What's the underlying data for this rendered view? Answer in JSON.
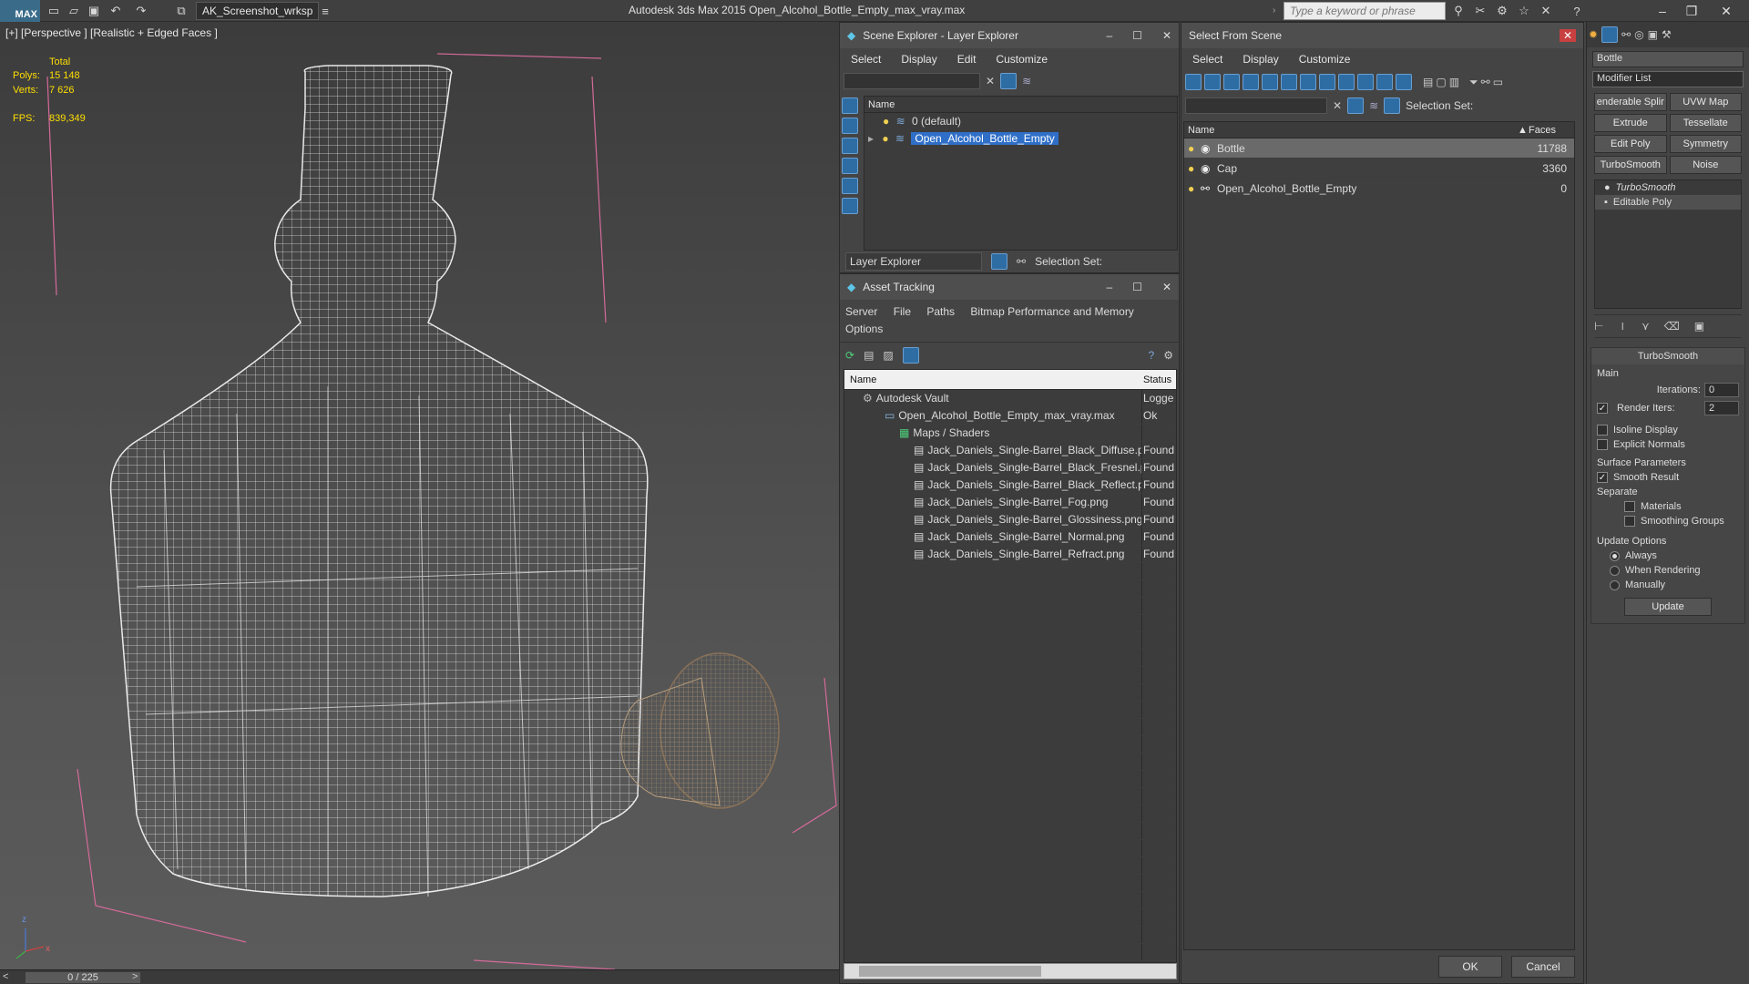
{
  "titlebar": {
    "logo": "MAX",
    "workspace": "AK_Screenshot_wrksp",
    "app_title": "Autodesk 3ds Max  2015     Open_Alcohol_Bottle_Empty_max_vray.max",
    "search_placeholder": "Type a keyword or phrase"
  },
  "viewport": {
    "label": "[+] [Perspective ] [Realistic + Edged Faces ]",
    "stats": {
      "total_label": "Total",
      "polys_label": "Polys:",
      "polys_value": "15 148",
      "verts_label": "Verts:",
      "verts_value": "7 626",
      "fps_label": "FPS:",
      "fps_value": "839,349"
    },
    "axis": {
      "z": "z",
      "x": "x"
    }
  },
  "timeline": {
    "frame": "0 / 225",
    "prev": "<",
    "next": ">"
  },
  "scene_explorer": {
    "title": "Scene Explorer - Layer Explorer",
    "menu": [
      "Select",
      "Display",
      "Edit",
      "Customize"
    ],
    "column_name": "Name",
    "layers": [
      "0 (default)",
      "Open_Alcohol_Bottle_Empty"
    ],
    "footer_dropdown": "Layer Explorer",
    "selection_set_label": "Selection Set:"
  },
  "asset_tracking": {
    "title": "Asset Tracking",
    "menu": [
      "Server",
      "File",
      "Paths",
      "Bitmap Performance and Memory",
      "Options"
    ],
    "columns": [
      "Name",
      "Status"
    ],
    "rows": [
      {
        "name": "Autodesk Vault",
        "status": "Logge"
      },
      {
        "name": "Open_Alcohol_Bottle_Empty_max_vray.max",
        "status": "Ok"
      },
      {
        "name": "Maps / Shaders",
        "status": ""
      },
      {
        "name": "Jack_Daniels_Single-Barrel_Black_Diffuse.p...",
        "status": "Found"
      },
      {
        "name": "Jack_Daniels_Single-Barrel_Black_Fresnel.p...",
        "status": "Found"
      },
      {
        "name": "Jack_Daniels_Single-Barrel_Black_Reflect.png",
        "status": "Found"
      },
      {
        "name": "Jack_Daniels_Single-Barrel_Fog.png",
        "status": "Found"
      },
      {
        "name": "Jack_Daniels_Single-Barrel_Glossiness.png",
        "status": "Found"
      },
      {
        "name": "Jack_Daniels_Single-Barrel_Normal.png",
        "status": "Found"
      },
      {
        "name": "Jack_Daniels_Single-Barrel_Refract.png",
        "status": "Found"
      }
    ]
  },
  "select_from_scene": {
    "title": "Select From Scene",
    "menu": [
      "Select",
      "Display",
      "Customize"
    ],
    "selection_set_label": "Selection Set:",
    "columns": [
      "Name",
      "Faces"
    ],
    "rows": [
      {
        "name": "Bottle",
        "faces": "11788"
      },
      {
        "name": "Cap",
        "faces": "3360"
      },
      {
        "name": "Open_Alcohol_Bottle_Empty",
        "faces": "0"
      }
    ],
    "ok": "OK",
    "cancel": "Cancel"
  },
  "command_panel": {
    "object_name": "Bottle",
    "modifier_list": "Modifier List",
    "buttons": [
      "enderable Splir",
      "UVW Map",
      "Extrude",
      "Tessellate",
      "Edit Poly",
      "Symmetry",
      "TurboSmooth",
      "Noise"
    ],
    "stack": [
      "TurboSmooth",
      "Editable Poly"
    ],
    "rollout_title": "TurboSmooth",
    "main_label": "Main",
    "iterations_label": "Iterations:",
    "iterations_value": "0",
    "render_iters_label": "Render Iters:",
    "render_iters_value": "2",
    "isoline_label": "Isoline Display",
    "explicit_normals_label": "Explicit Normals",
    "surface_params_label": "Surface Parameters",
    "smooth_result_label": "Smooth Result",
    "separate_label": "Separate",
    "materials_label": "Materials",
    "smoothing_groups_label": "Smoothing Groups",
    "update_options_label": "Update Options",
    "always_label": "Always",
    "when_rendering_label": "When Rendering",
    "manually_label": "Manually",
    "update_button": "Update"
  }
}
